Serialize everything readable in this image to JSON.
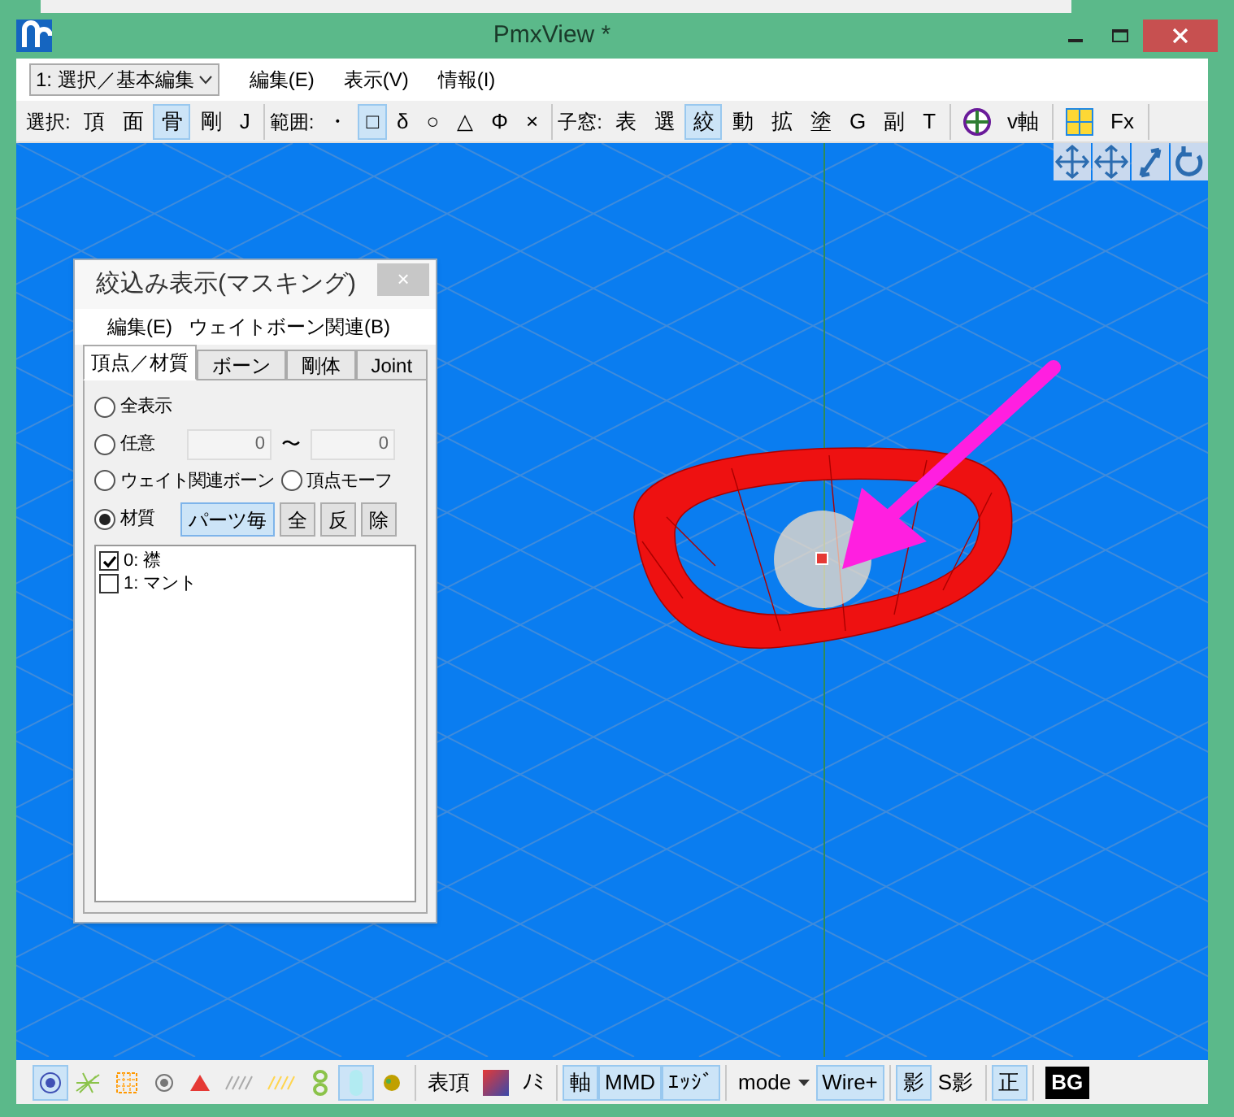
{
  "window": {
    "title": "PmxView *"
  },
  "mode_select": {
    "value": "1: 選択／基本編集"
  },
  "menu": [
    "編集(E)",
    "表示(V)",
    "情報(I)"
  ],
  "toolbar": [
    {
      "label": "選択:",
      "buttons": [
        {
          "text": "頂",
          "selected": false
        },
        {
          "text": "面",
          "selected": false
        },
        {
          "text": "骨",
          "selected": true
        },
        {
          "text": "剛",
          "selected": false
        },
        {
          "text": "J",
          "selected": false
        }
      ]
    },
    {
      "label": "範囲:",
      "buttons": [
        {
          "text": "・",
          "selected": false
        },
        {
          "text": "□",
          "selected": true
        },
        {
          "text": "δ",
          "selected": false
        },
        {
          "text": "○",
          "selected": false
        },
        {
          "text": "△",
          "selected": false
        },
        {
          "text": "Φ",
          "selected": false
        },
        {
          "text": "×",
          "selected": false
        }
      ]
    },
    {
      "label": "子窓:",
      "buttons": [
        {
          "text": "表",
          "selected": false
        },
        {
          "text": "選",
          "selected": false
        },
        {
          "text": "絞",
          "selected": true
        },
        {
          "text": "動",
          "selected": false
        },
        {
          "text": "拡",
          "selected": false
        },
        {
          "text": "塗",
          "selected": false
        },
        {
          "text": "G",
          "selected": false
        },
        {
          "text": "副",
          "selected": false
        },
        {
          "text": "T",
          "selected": false
        }
      ]
    },
    {
      "buttons": [
        {
          "kind": "axis",
          "text": "v軸",
          "selected": false
        }
      ]
    },
    {
      "buttons": [
        {
          "kind": "grid",
          "text": "Fx",
          "selected": false
        }
      ]
    }
  ],
  "dialog": {
    "title": "絞込み表示(マスキング)",
    "close": "×",
    "menu": [
      "編集(E)",
      "ウェイトボーン関連(B)"
    ],
    "tabs": [
      {
        "label": "頂点／材質",
        "selected": true
      },
      {
        "label": "ボーン",
        "selected": false
      },
      {
        "label": "剛体",
        "selected": false
      },
      {
        "label": "Joint",
        "selected": false
      }
    ],
    "options": [
      {
        "label": "全表示",
        "selected": false
      },
      {
        "label": "任意",
        "selected": false,
        "from": "0",
        "separator": "〜",
        "to": "0"
      },
      {
        "label": "ウェイト関連ボーン",
        "selected": false
      },
      {
        "label": "頂点モーフ",
        "selected": false
      },
      {
        "label": "材質",
        "selected": true
      }
    ],
    "buttons": [
      {
        "text": "パーツ毎",
        "selected": true
      },
      {
        "text": "全",
        "selected": false
      },
      {
        "text": "反",
        "selected": false
      },
      {
        "text": "除",
        "selected": false
      }
    ],
    "materials": [
      {
        "label": "0: 襟",
        "checked": true
      },
      {
        "label": "1: マント",
        "checked": false
      }
    ]
  },
  "bottom_toolbar": [
    {
      "kind": "target",
      "selected": true
    },
    {
      "kind": "sparkle",
      "selected": false
    },
    {
      "kind": "mesh",
      "selected": false
    },
    {
      "kind": "dot",
      "selected": false
    },
    {
      "kind": "triangle",
      "selected": false
    },
    {
      "kind": "hatch",
      "selected": false
    },
    {
      "kind": "hatch2",
      "selected": false
    },
    {
      "kind": "chain",
      "selected": false
    },
    {
      "kind": "capsule",
      "selected": true
    },
    {
      "kind": "blob",
      "selected": false
    },
    {
      "kind": "sep"
    },
    {
      "kind": "text",
      "text": "表頂",
      "selected": false
    },
    {
      "kind": "gradient",
      "selected": false
    },
    {
      "kind": "text",
      "text": "ﾉﾐ",
      "selected": false
    },
    {
      "kind": "sep"
    },
    {
      "kind": "text",
      "text": "軸",
      "selected": true
    },
    {
      "kind": "text",
      "text": "MMD",
      "selected": true
    },
    {
      "kind": "text",
      "text": "ｴｯｼﾞ",
      "selected": true
    },
    {
      "kind": "sep"
    },
    {
      "kind": "dropdown",
      "text": "mode",
      "selected": false
    },
    {
      "kind": "text",
      "text": "Wire+",
      "selected": true
    },
    {
      "kind": "sep"
    },
    {
      "kind": "text",
      "text": "影",
      "selected": true
    },
    {
      "kind": "text",
      "text": "S影",
      "selected": false
    },
    {
      "kind": "sep"
    },
    {
      "kind": "text",
      "text": "正",
      "selected": true
    },
    {
      "kind": "sep"
    },
    {
      "kind": "black",
      "text": "BG",
      "selected": false
    }
  ]
}
